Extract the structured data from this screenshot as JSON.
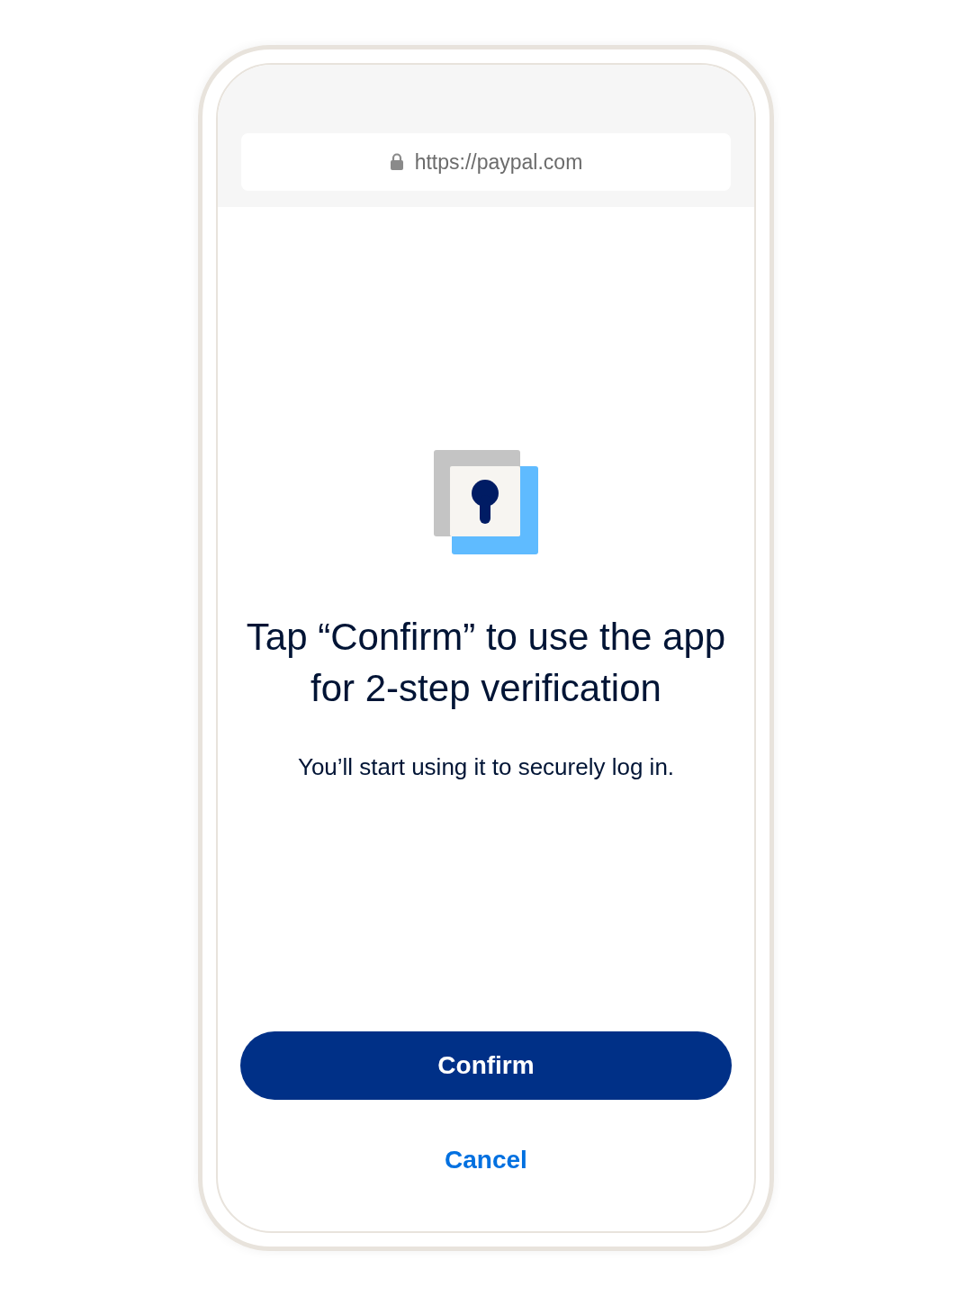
{
  "browser": {
    "url": "https://paypal.com"
  },
  "title": "Tap “Confirm” to use the app for 2-step verification",
  "subtitle": "You’ll start using it to securely log in.",
  "buttons": [
    {
      "label": "Confirm",
      "kind": "primary"
    },
    {
      "label": "Cancel",
      "kind": "link"
    }
  ]
}
